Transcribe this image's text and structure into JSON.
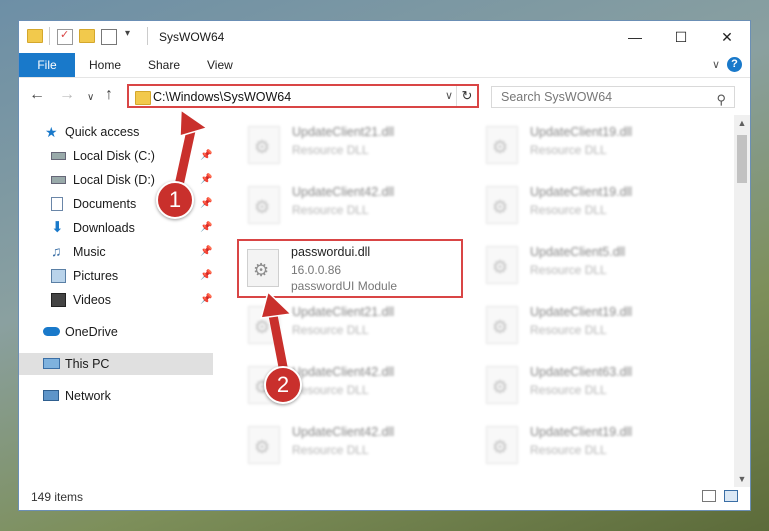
{
  "window": {
    "title": "SysWOW64"
  },
  "ribbon": {
    "file": "File",
    "home": "Home",
    "share": "Share",
    "view": "View"
  },
  "nav": {
    "address": "C:\\Windows\\SysWOW64",
    "search_placeholder": "Search SysWOW64"
  },
  "sidebar": {
    "items": [
      {
        "label": "Quick access"
      },
      {
        "label": "Local Disk (C:)"
      },
      {
        "label": "Local Disk (D:)"
      },
      {
        "label": "Documents"
      },
      {
        "label": "Downloads"
      },
      {
        "label": "Music"
      },
      {
        "label": "Pictures"
      },
      {
        "label": "Videos"
      },
      {
        "label": "OneDrive"
      },
      {
        "label": "This PC"
      },
      {
        "label": "Network"
      }
    ]
  },
  "files": {
    "left": [
      {
        "name": "UpdateClient21.dll",
        "desc": "Resource DLL"
      },
      {
        "name": "UpdateClient42.dll",
        "desc": "Resource DLL"
      },
      {
        "name": "passwordui.dll",
        "version": "16.0.0.86",
        "desc": "passwordUI Module"
      },
      {
        "name": "UpdateClient21.dll",
        "desc": "Resource DLL"
      },
      {
        "name": "UpdateClient42.dll",
        "desc": "Resource DLL"
      },
      {
        "name": "UpdateClient42.dll",
        "desc": "Resource DLL"
      }
    ],
    "right": [
      {
        "name": "UpdateClient19.dll",
        "desc": "Resource DLL"
      },
      {
        "name": "UpdateClient19.dll",
        "desc": "Resource DLL"
      },
      {
        "name": "UpdateClient5.dll",
        "desc": "Resource DLL"
      },
      {
        "name": "UpdateClient19.dll",
        "desc": "Resource DLL"
      },
      {
        "name": "UpdateClient63.dll",
        "desc": "Resource DLL"
      },
      {
        "name": "UpdateClient19.dll",
        "desc": "Resource DLL"
      }
    ]
  },
  "status": {
    "count": "149 items"
  },
  "callouts": {
    "one": "1",
    "two": "2"
  },
  "colors": {
    "accent": "#1979ca",
    "callout": "#c9302c",
    "highlight": "#d94545"
  }
}
